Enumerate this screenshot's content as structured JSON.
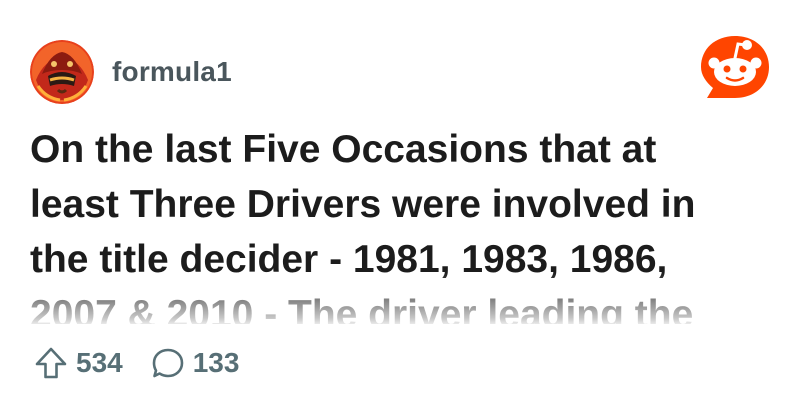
{
  "post": {
    "subreddit": "formula1",
    "title": "On the last Five Occasions that at least Three Drivers were involved in the title decider - 1981, 1983, 1986, 2007 & 2010 - The driver leading the",
    "upvotes": "534",
    "comments": "133"
  },
  "icons": {
    "avatar": "subreddit-avatar-icon",
    "logo": "reddit-logo-icon",
    "upvote": "upvote-arrow-icon",
    "comment": "comment-bubble-icon"
  },
  "colors": {
    "brand": "#ff4500",
    "title": "#1c1c1c",
    "meta": "#576f76",
    "background": "#ffffff"
  }
}
